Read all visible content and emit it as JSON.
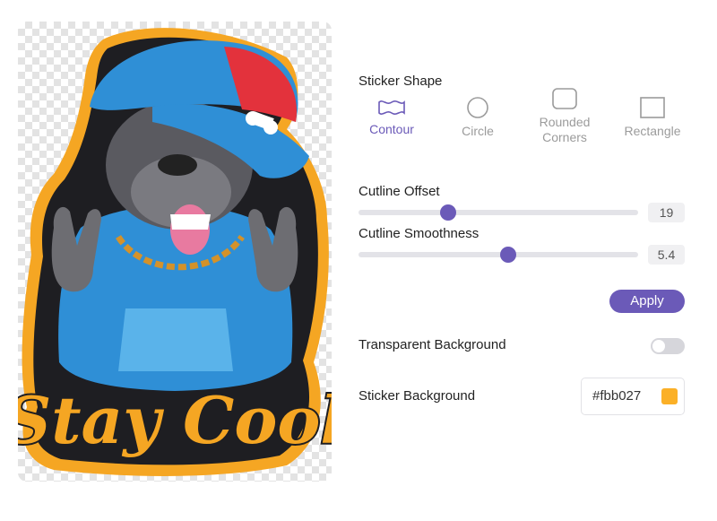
{
  "preview": {
    "image_alt": "Bulldog sticker wearing cap, chain and hoodie with 'Stay Cool' text",
    "artwork_text": "Stay Cool"
  },
  "sticker_shape": {
    "title": "Sticker Shape",
    "options": [
      {
        "label": "Contour",
        "icon": "contour-wave-icon",
        "active": true
      },
      {
        "label": "Circle",
        "icon": "circle-icon",
        "active": false
      },
      {
        "label": "Rounded\nCorners",
        "label_line1": "Rounded",
        "label_line2": "Corners",
        "icon": "rounded-square-icon",
        "active": false
      },
      {
        "label": "Rectangle",
        "icon": "rectangle-icon",
        "active": false
      }
    ]
  },
  "cutline_offset": {
    "label": "Cutline Offset",
    "value": "19",
    "fraction": 0.32
  },
  "cutline_smoothness": {
    "label": "Cutline Smoothness",
    "value": "5.4",
    "fraction": 0.535
  },
  "apply_label": "Apply",
  "transparent_background": {
    "label": "Transparent Background",
    "enabled": false
  },
  "sticker_background": {
    "label": "Sticker Background",
    "hex": "#fbb027"
  },
  "colors": {
    "accent": "#6b5ab8",
    "sticker_bg": "#fbb027",
    "outline": "#f5a623"
  }
}
